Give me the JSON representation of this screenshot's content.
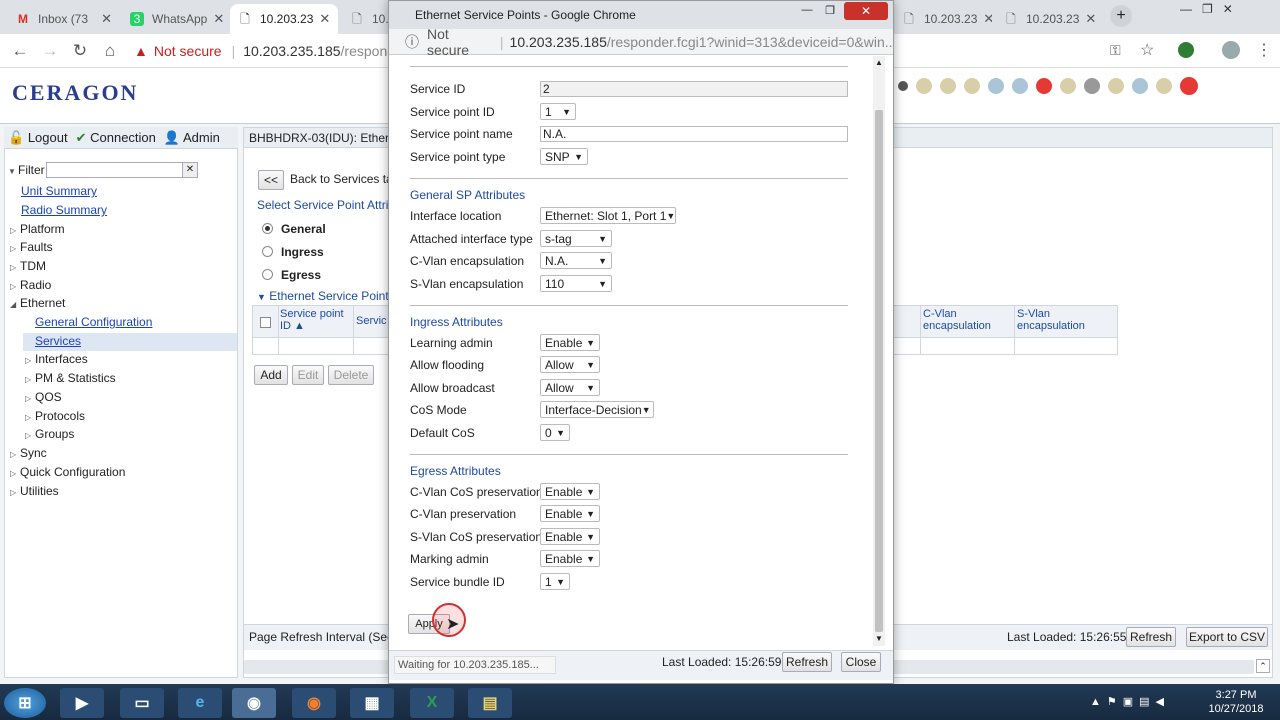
{
  "browser": {
    "tabs": [
      {
        "label": "Inbox (73"
      },
      {
        "label": "WhatsApp"
      },
      {
        "label": "10.203.23"
      },
      {
        "label": "10."
      },
      {
        "label": "10.203.23"
      },
      {
        "label": "10.203.23"
      }
    ],
    "not_secure": "Not secure",
    "url_host": "10.203.235.185",
    "url_path": "/responder"
  },
  "app": {
    "logo": "CERAGON",
    "userbar": {
      "logout": "Logout",
      "connection": "Connection",
      "admin": "Admin"
    },
    "filter_label": "Filter",
    "tree": {
      "unit_summary": "Unit Summary",
      "radio_summary": "Radio Summary",
      "platform": "Platform",
      "faults": "Faults",
      "tdm": "TDM",
      "radio": "Radio",
      "ethernet": "Ethernet",
      "general_configuration": "General Configuration",
      "services": "Services",
      "interfaces": "Interfaces",
      "pm_statistics": "PM & Statistics",
      "qos": "QOS",
      "protocols": "Protocols",
      "groups": "Groups",
      "sync": "Sync",
      "quick_configuration": "Quick Configuration",
      "utilities": "Utilities"
    },
    "main": {
      "title": "BHBHDRX-03(IDU): Ether",
      "back_btn": "<<",
      "back_label": "Back to Services ta",
      "select_label": "Select Service Point Attri",
      "radio_general": "General",
      "radio_ingress": "Ingress",
      "radio_egress": "Egress",
      "section": "Ethernet Service Point",
      "col_sp_id": "Service point ID ▲",
      "col_service": "Servic",
      "col_cvlan": "C-Vlan encapsulation",
      "col_svlan": "S-Vlan encapsulation",
      "btn_add": "Add",
      "btn_edit": "Edit",
      "btn_delete": "Delete",
      "refresh_interval": "Page Refresh Interval (Sec",
      "last_loaded": "Last Loaded: 15:26:55",
      "btn_refresh": "Refresh",
      "btn_export": "Export to CSV"
    }
  },
  "popup": {
    "title": "Ethernet Service Points - Google Chrome",
    "not_secure": "Not secure",
    "url_host": "10.203.235.185",
    "url_path": "/responder.fcgi1?winid=313&deviceid=0&win...",
    "fields": {
      "service_id": {
        "label": "Service ID",
        "value": "2"
      },
      "service_point_id": {
        "label": "Service point ID",
        "value": "1"
      },
      "service_point_name": {
        "label": "Service point name",
        "value": "N.A."
      },
      "service_point_type": {
        "label": "Service point type",
        "value": "SNP"
      }
    },
    "general_sp": {
      "title": "General SP Attributes",
      "interface_location": {
        "label": "Interface location",
        "value": "Ethernet: Slot 1, Port 1"
      },
      "attached_interface_type": {
        "label": "Attached interface type",
        "value": "s-tag"
      },
      "cvlan_encapsulation": {
        "label": "C-Vlan encapsulation",
        "value": "N.A."
      },
      "svlan_encapsulation": {
        "label": "S-Vlan encapsulation",
        "value": "110"
      }
    },
    "ingress": {
      "title": "Ingress Attributes",
      "learning_admin": {
        "label": "Learning admin",
        "value": "Enable"
      },
      "allow_flooding": {
        "label": "Allow flooding",
        "value": "Allow"
      },
      "allow_broadcast": {
        "label": "Allow broadcast",
        "value": "Allow"
      },
      "cos_mode": {
        "label": "CoS Mode",
        "value": "Interface-Decision"
      },
      "default_cos": {
        "label": "Default CoS",
        "value": "0"
      }
    },
    "egress": {
      "title": "Egress Attributes",
      "cvlan_cos_preservation": {
        "label": "C-Vlan CoS preservation",
        "value": "Enable"
      },
      "cvlan_preservation": {
        "label": "C-Vlan preservation",
        "value": "Enable"
      },
      "svlan_cos_preservation": {
        "label": "S-Vlan CoS preservation",
        "value": "Enable"
      },
      "marking_admin": {
        "label": "Marking admin",
        "value": "Enable"
      },
      "service_bundle_id": {
        "label": "Service bundle ID",
        "value": "1"
      }
    },
    "apply": "Apply",
    "status": "Waiting for 10.203.235.185...",
    "last_loaded": "Last Loaded: 15:26:59",
    "refresh": "Refresh",
    "close": "Close"
  },
  "taskbar": {
    "time": "3:27 PM",
    "date": "10/27/2018"
  },
  "colors": {
    "accent_blue": "#1d4aa3",
    "not_secure_red": "#c5221f",
    "logo_blue": "#2a3d8f"
  }
}
